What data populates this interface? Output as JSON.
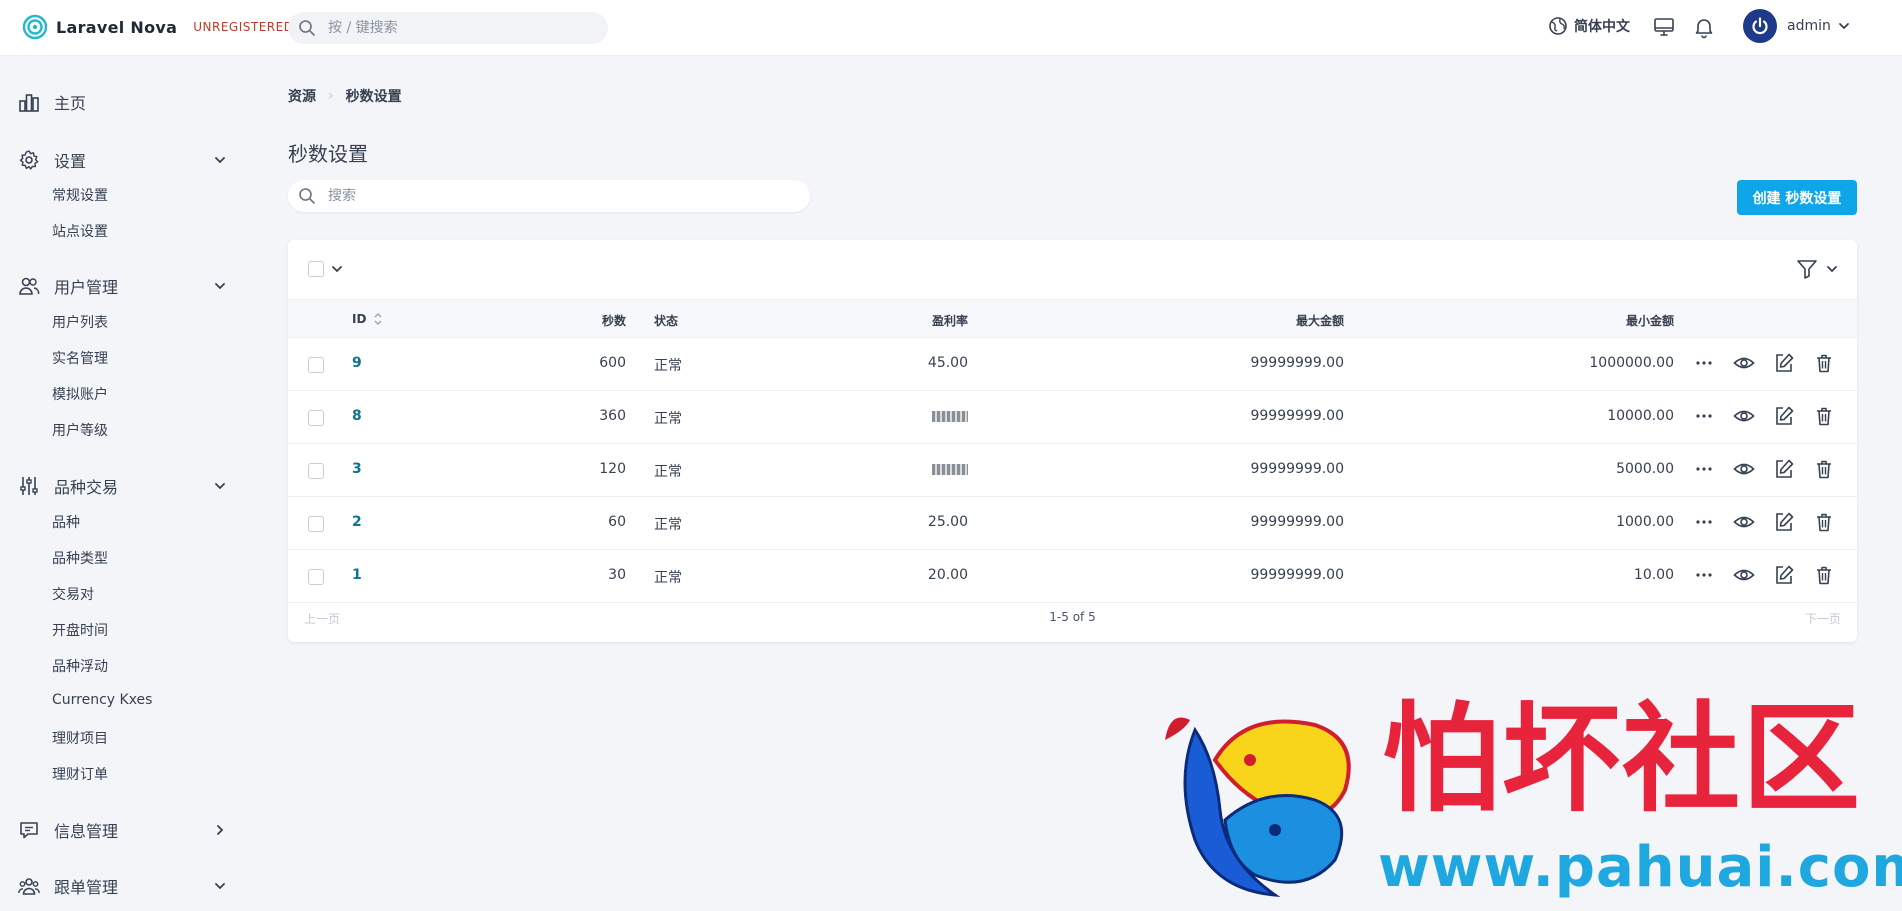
{
  "header": {
    "brand": "Laravel Nova",
    "tag": "UNREGISTERED",
    "search_placeholder": "按 / 键搜索",
    "language": "简体中文",
    "user": "admin"
  },
  "sidebar": {
    "home": "主页",
    "groups": [
      {
        "label": "设置",
        "items": [
          "常规设置",
          "站点设置"
        ]
      },
      {
        "label": "用户管理",
        "items": [
          "用户列表",
          "实名管理",
          "模拟账户",
          "用户等级"
        ]
      },
      {
        "label": "品种交易",
        "items": [
          "品种",
          "品种类型",
          "交易对",
          "开盘时间",
          "品种浮动",
          "Currency Kxes",
          "理财项目",
          "理财订单"
        ]
      },
      {
        "label": "信息管理",
        "items": []
      },
      {
        "label": "跟单管理",
        "items": []
      }
    ]
  },
  "breadcrumb": {
    "root": "资源",
    "current": "秒数设置"
  },
  "page": {
    "title": "秒数设置",
    "search_placeholder": "搜索",
    "create_label": "创建 秒数设置"
  },
  "table": {
    "columns": {
      "id": "ID",
      "seconds": "秒数",
      "status": "状态",
      "profit": "盈利率",
      "max": "最大金额",
      "min": "最小金额"
    },
    "rows": [
      {
        "id": "9",
        "seconds": "600",
        "status": "正常",
        "profit": "45.00",
        "max": "99999999.00",
        "min": "1000000.00"
      },
      {
        "id": "8",
        "seconds": "360",
        "status": "正常",
        "profit": "",
        "max": "99999999.00",
        "min": "10000.00"
      },
      {
        "id": "3",
        "seconds": "120",
        "status": "正常",
        "profit": "",
        "max": "99999999.00",
        "min": "5000.00"
      },
      {
        "id": "2",
        "seconds": "60",
        "status": "正常",
        "profit": "25.00",
        "max": "99999999.00",
        "min": "1000.00"
      },
      {
        "id": "1",
        "seconds": "30",
        "status": "正常",
        "profit": "20.00",
        "max": "99999999.00",
        "min": "10.00"
      }
    ],
    "pager": {
      "prev": "上一页",
      "info": "1-5 of 5",
      "next": "下一页"
    }
  },
  "watermark": {
    "text": "怕坏社区",
    "url": "www.pahuai.com"
  },
  "colors": {
    "accent": "#0ea5e9",
    "link": "#0e7490",
    "tag": "#c0392b",
    "watermark_red": "#e8233c",
    "watermark_blue": "#1fa7df"
  }
}
